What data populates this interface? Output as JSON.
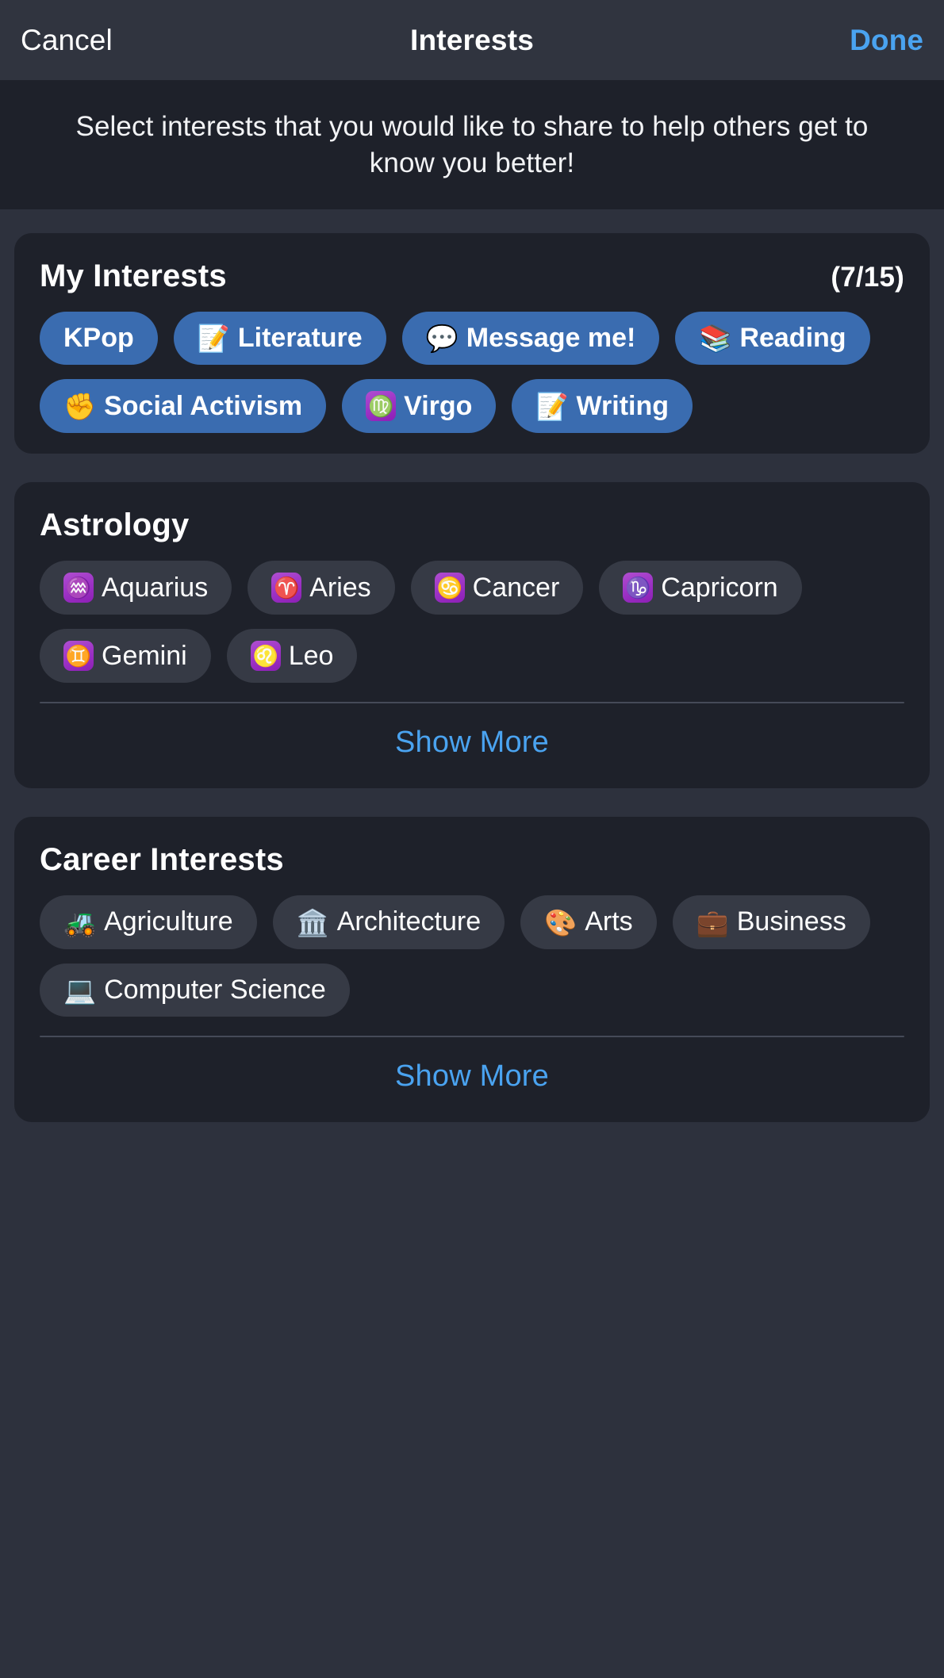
{
  "navbar": {
    "cancel_label": "Cancel",
    "title": "Interests",
    "done_label": "Done",
    "done_color": "#4aa3f0"
  },
  "subtitle": "Select interests that you would like to share to help others get to know you better!",
  "colors": {
    "page_background": "#2d313d",
    "card_background": "#1e212a",
    "navbar_background": "#30343f",
    "chip_selected": "#3a6cb0",
    "chip_unselected": "#363a45",
    "accent_blue": "#4aa3f0",
    "zodiac_purple": "#9b31c4"
  },
  "sections": [
    {
      "id": "my-interests",
      "title": "My Interests",
      "count": "(7/15)",
      "has_show_more": false,
      "chips": [
        {
          "label": "KPop",
          "emoji": "",
          "zodiac": "",
          "selected": true
        },
        {
          "label": "Literature",
          "emoji": "📝",
          "zodiac": "",
          "selected": true
        },
        {
          "label": "Message me!",
          "emoji": "💬",
          "zodiac": "",
          "selected": true
        },
        {
          "label": "Reading",
          "emoji": "📚",
          "zodiac": "",
          "selected": true
        },
        {
          "label": "Social Activism",
          "emoji": "✊",
          "zodiac": "",
          "selected": true
        },
        {
          "label": "Virgo",
          "emoji": "",
          "zodiac": "♍",
          "selected": true
        },
        {
          "label": "Writing",
          "emoji": "📝",
          "zodiac": "",
          "selected": true
        }
      ]
    },
    {
      "id": "astrology",
      "title": "Astrology",
      "count": "",
      "has_show_more": true,
      "show_more_label": "Show More",
      "chips": [
        {
          "label": "Aquarius",
          "emoji": "",
          "zodiac": "♒",
          "selected": false
        },
        {
          "label": "Aries",
          "emoji": "",
          "zodiac": "♈",
          "selected": false
        },
        {
          "label": "Cancer",
          "emoji": "",
          "zodiac": "♋",
          "selected": false
        },
        {
          "label": "Capricorn",
          "emoji": "",
          "zodiac": "♑",
          "selected": false
        },
        {
          "label": "Gemini",
          "emoji": "",
          "zodiac": "♊",
          "selected": false
        },
        {
          "label": "Leo",
          "emoji": "",
          "zodiac": "♌",
          "selected": false
        }
      ]
    },
    {
      "id": "career-interests",
      "title": "Career Interests",
      "count": "",
      "has_show_more": true,
      "show_more_label": "Show More",
      "chips": [
        {
          "label": "Agriculture",
          "emoji": "🚜",
          "zodiac": "",
          "selected": false
        },
        {
          "label": "Architecture",
          "emoji": "🏛️",
          "zodiac": "",
          "selected": false
        },
        {
          "label": "Arts",
          "emoji": "🎨",
          "zodiac": "",
          "selected": false
        },
        {
          "label": "Business",
          "emoji": "💼",
          "zodiac": "",
          "selected": false
        },
        {
          "label": "Computer Science",
          "emoji": "💻",
          "zodiac": "",
          "selected": false
        }
      ]
    }
  ]
}
